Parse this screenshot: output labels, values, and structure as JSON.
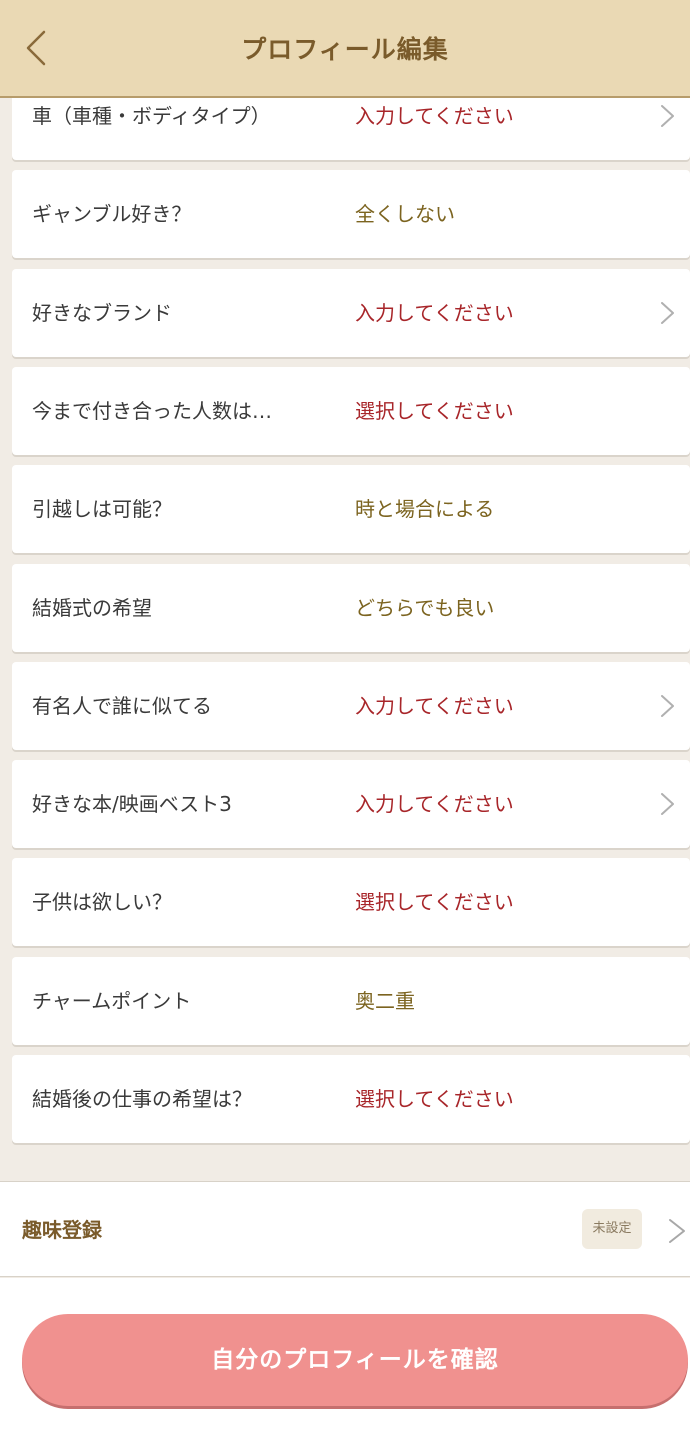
{
  "header": {
    "title": "プロフィール編集",
    "back_icon": "chevron-left-icon"
  },
  "rows": [
    {
      "label": "車（車種・ボディタイプ）",
      "value": "入力してください",
      "state": "placeholder",
      "chevron": true
    },
    {
      "label": "ギャンブル好き？",
      "value": "全くしない",
      "state": "set",
      "chevron": false
    },
    {
      "label": "好きなブランド",
      "value": "入力してください",
      "state": "placeholder",
      "chevron": true
    },
    {
      "label": "今まで付き合った人数は…",
      "value": "選択してください",
      "state": "placeholder",
      "chevron": false
    },
    {
      "label": "引越しは可能？",
      "value": "時と場合による",
      "state": "set",
      "chevron": false
    },
    {
      "label": "結婚式の希望",
      "value": "どちらでも良い",
      "state": "set",
      "chevron": false
    },
    {
      "label": "有名人で誰に似てる",
      "value": "入力してください",
      "state": "placeholder",
      "chevron": true
    },
    {
      "label": "好きな本/映画ベスト3",
      "value": "入力してください",
      "state": "placeholder",
      "chevron": true
    },
    {
      "label": "子供は欲しい？",
      "value": "選択してください",
      "state": "placeholder",
      "chevron": false
    },
    {
      "label": "チャームポイント",
      "value": "奥二重",
      "state": "set",
      "chevron": false
    },
    {
      "label": "結婚後の仕事の希望は？",
      "value": "選択してください",
      "state": "placeholder",
      "chevron": false
    }
  ],
  "hobby": {
    "label": "趣味登録",
    "badge": "未設定"
  },
  "confirm_button": {
    "label": "自分のプロフィールを確認"
  },
  "colors": {
    "header_bg": "#ead9b4",
    "placeholder_text": "#a8262a",
    "set_text": "#7c6420",
    "button_bg": "#f0918f"
  }
}
